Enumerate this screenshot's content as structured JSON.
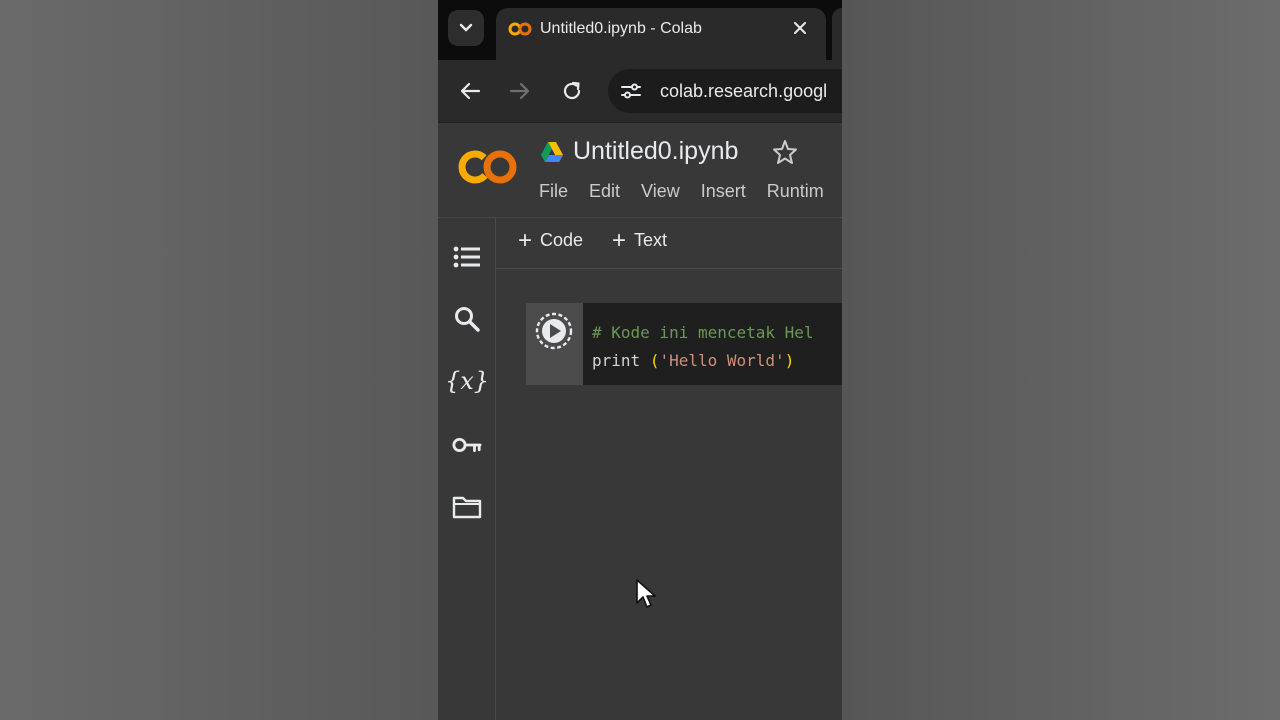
{
  "browser": {
    "tab_title": "Untitled0.ipynb - Colab",
    "url": "colab.research.googl"
  },
  "notebook": {
    "title": "Untitled0.ipynb",
    "menu": [
      "File",
      "Edit",
      "View",
      "Insert",
      "Runtim"
    ]
  },
  "toolbar": {
    "add_code_label": "Code",
    "add_text_label": "Text"
  },
  "cell": {
    "comment_line": "# Kode ini mencetak Hel",
    "print_kw": "print",
    "print_open": "(",
    "print_string": "'Hello World'",
    "print_close": ")"
  },
  "rail": {
    "icons": [
      "table-of-contents-icon",
      "search-icon",
      "variables-icon",
      "secrets-key-icon",
      "files-folder-icon"
    ],
    "variables_glyph": "{x}"
  },
  "colors": {
    "colab_orange": "#F9AB00",
    "colab_dark_orange": "#E8710A",
    "background": "#383838",
    "comment_green": "#6a9955"
  }
}
